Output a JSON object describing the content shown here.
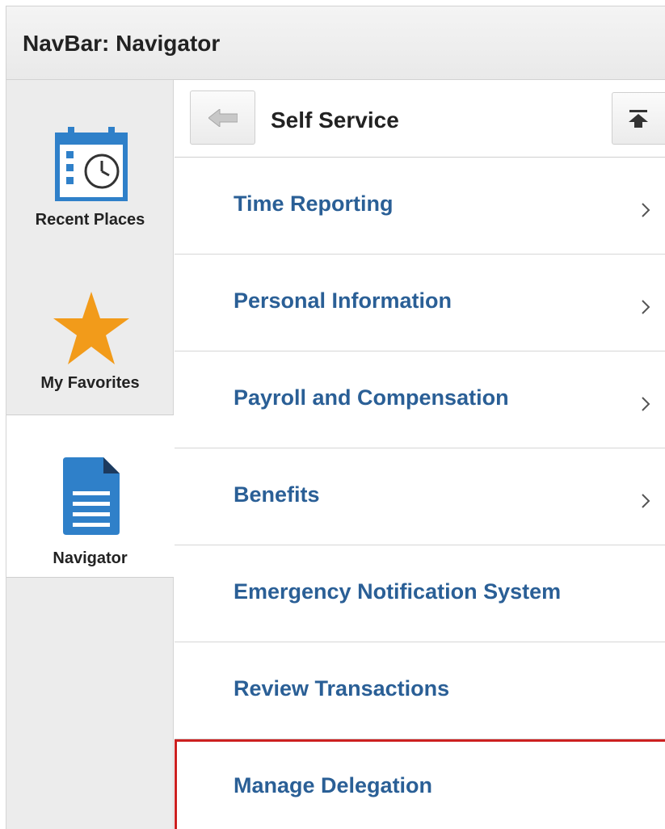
{
  "titlebar": {
    "title": "NavBar: Navigator"
  },
  "sidebar": {
    "items": [
      {
        "label": "Recent Places",
        "icon": "calendar-clock-icon"
      },
      {
        "label": "My Favorites",
        "icon": "star-icon"
      },
      {
        "label": "Navigator",
        "icon": "document-icon",
        "active": true
      }
    ]
  },
  "header": {
    "back_icon": "back-arrow-icon",
    "title": "Self Service",
    "top_icon": "scroll-to-top-icon"
  },
  "menu": {
    "items": [
      {
        "label": "Time Reporting",
        "has_children": true
      },
      {
        "label": "Personal Information",
        "has_children": true
      },
      {
        "label": "Payroll and Compensation",
        "has_children": true
      },
      {
        "label": "Benefits",
        "has_children": true
      },
      {
        "label": "Emergency Notification System",
        "has_children": false
      },
      {
        "label": "Review Transactions",
        "has_children": false
      },
      {
        "label": "Manage Delegation",
        "has_children": false,
        "highlighted": true
      }
    ]
  },
  "colors": {
    "link_blue": "#2a5f96",
    "highlight_red": "#cc2020",
    "icon_blue": "#2f80c9",
    "star_orange": "#f29b1a"
  }
}
